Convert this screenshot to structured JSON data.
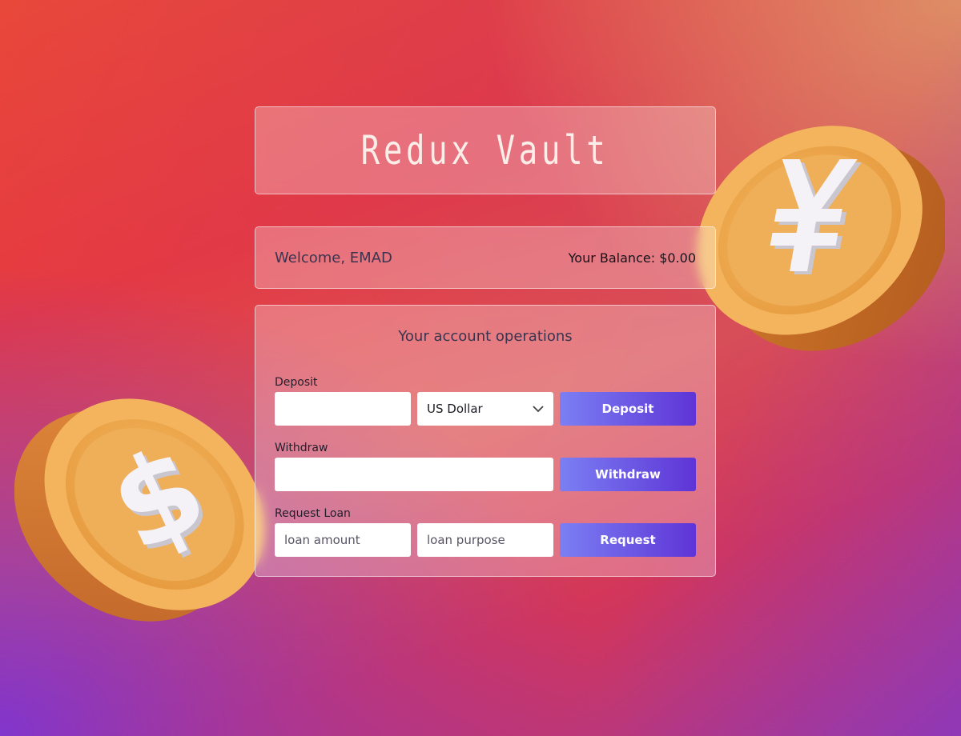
{
  "app": {
    "title": "Redux Vault"
  },
  "header": {
    "welcome": "Welcome, EMAD",
    "balance": "Your Balance: $0.00"
  },
  "operations": {
    "title": "Your account operations",
    "deposit": {
      "label": "Deposit",
      "amount_value": "",
      "currency_selected": "US Dollar",
      "button": "Deposit"
    },
    "withdraw": {
      "label": "Withdraw",
      "amount_value": "",
      "button": "Withdraw"
    },
    "loan": {
      "label": "Request Loan",
      "amount_placeholder": "loan amount",
      "purpose_placeholder": "loan purpose",
      "button": "Request"
    }
  },
  "decorations": {
    "coin_left": "dollar-coin-icon",
    "coin_right": "yen-coin-icon"
  },
  "colors": {
    "button_gradient_start": "#7b7ff3",
    "button_gradient_end": "#5e34d6",
    "coin_gold": "#f0a94a"
  }
}
